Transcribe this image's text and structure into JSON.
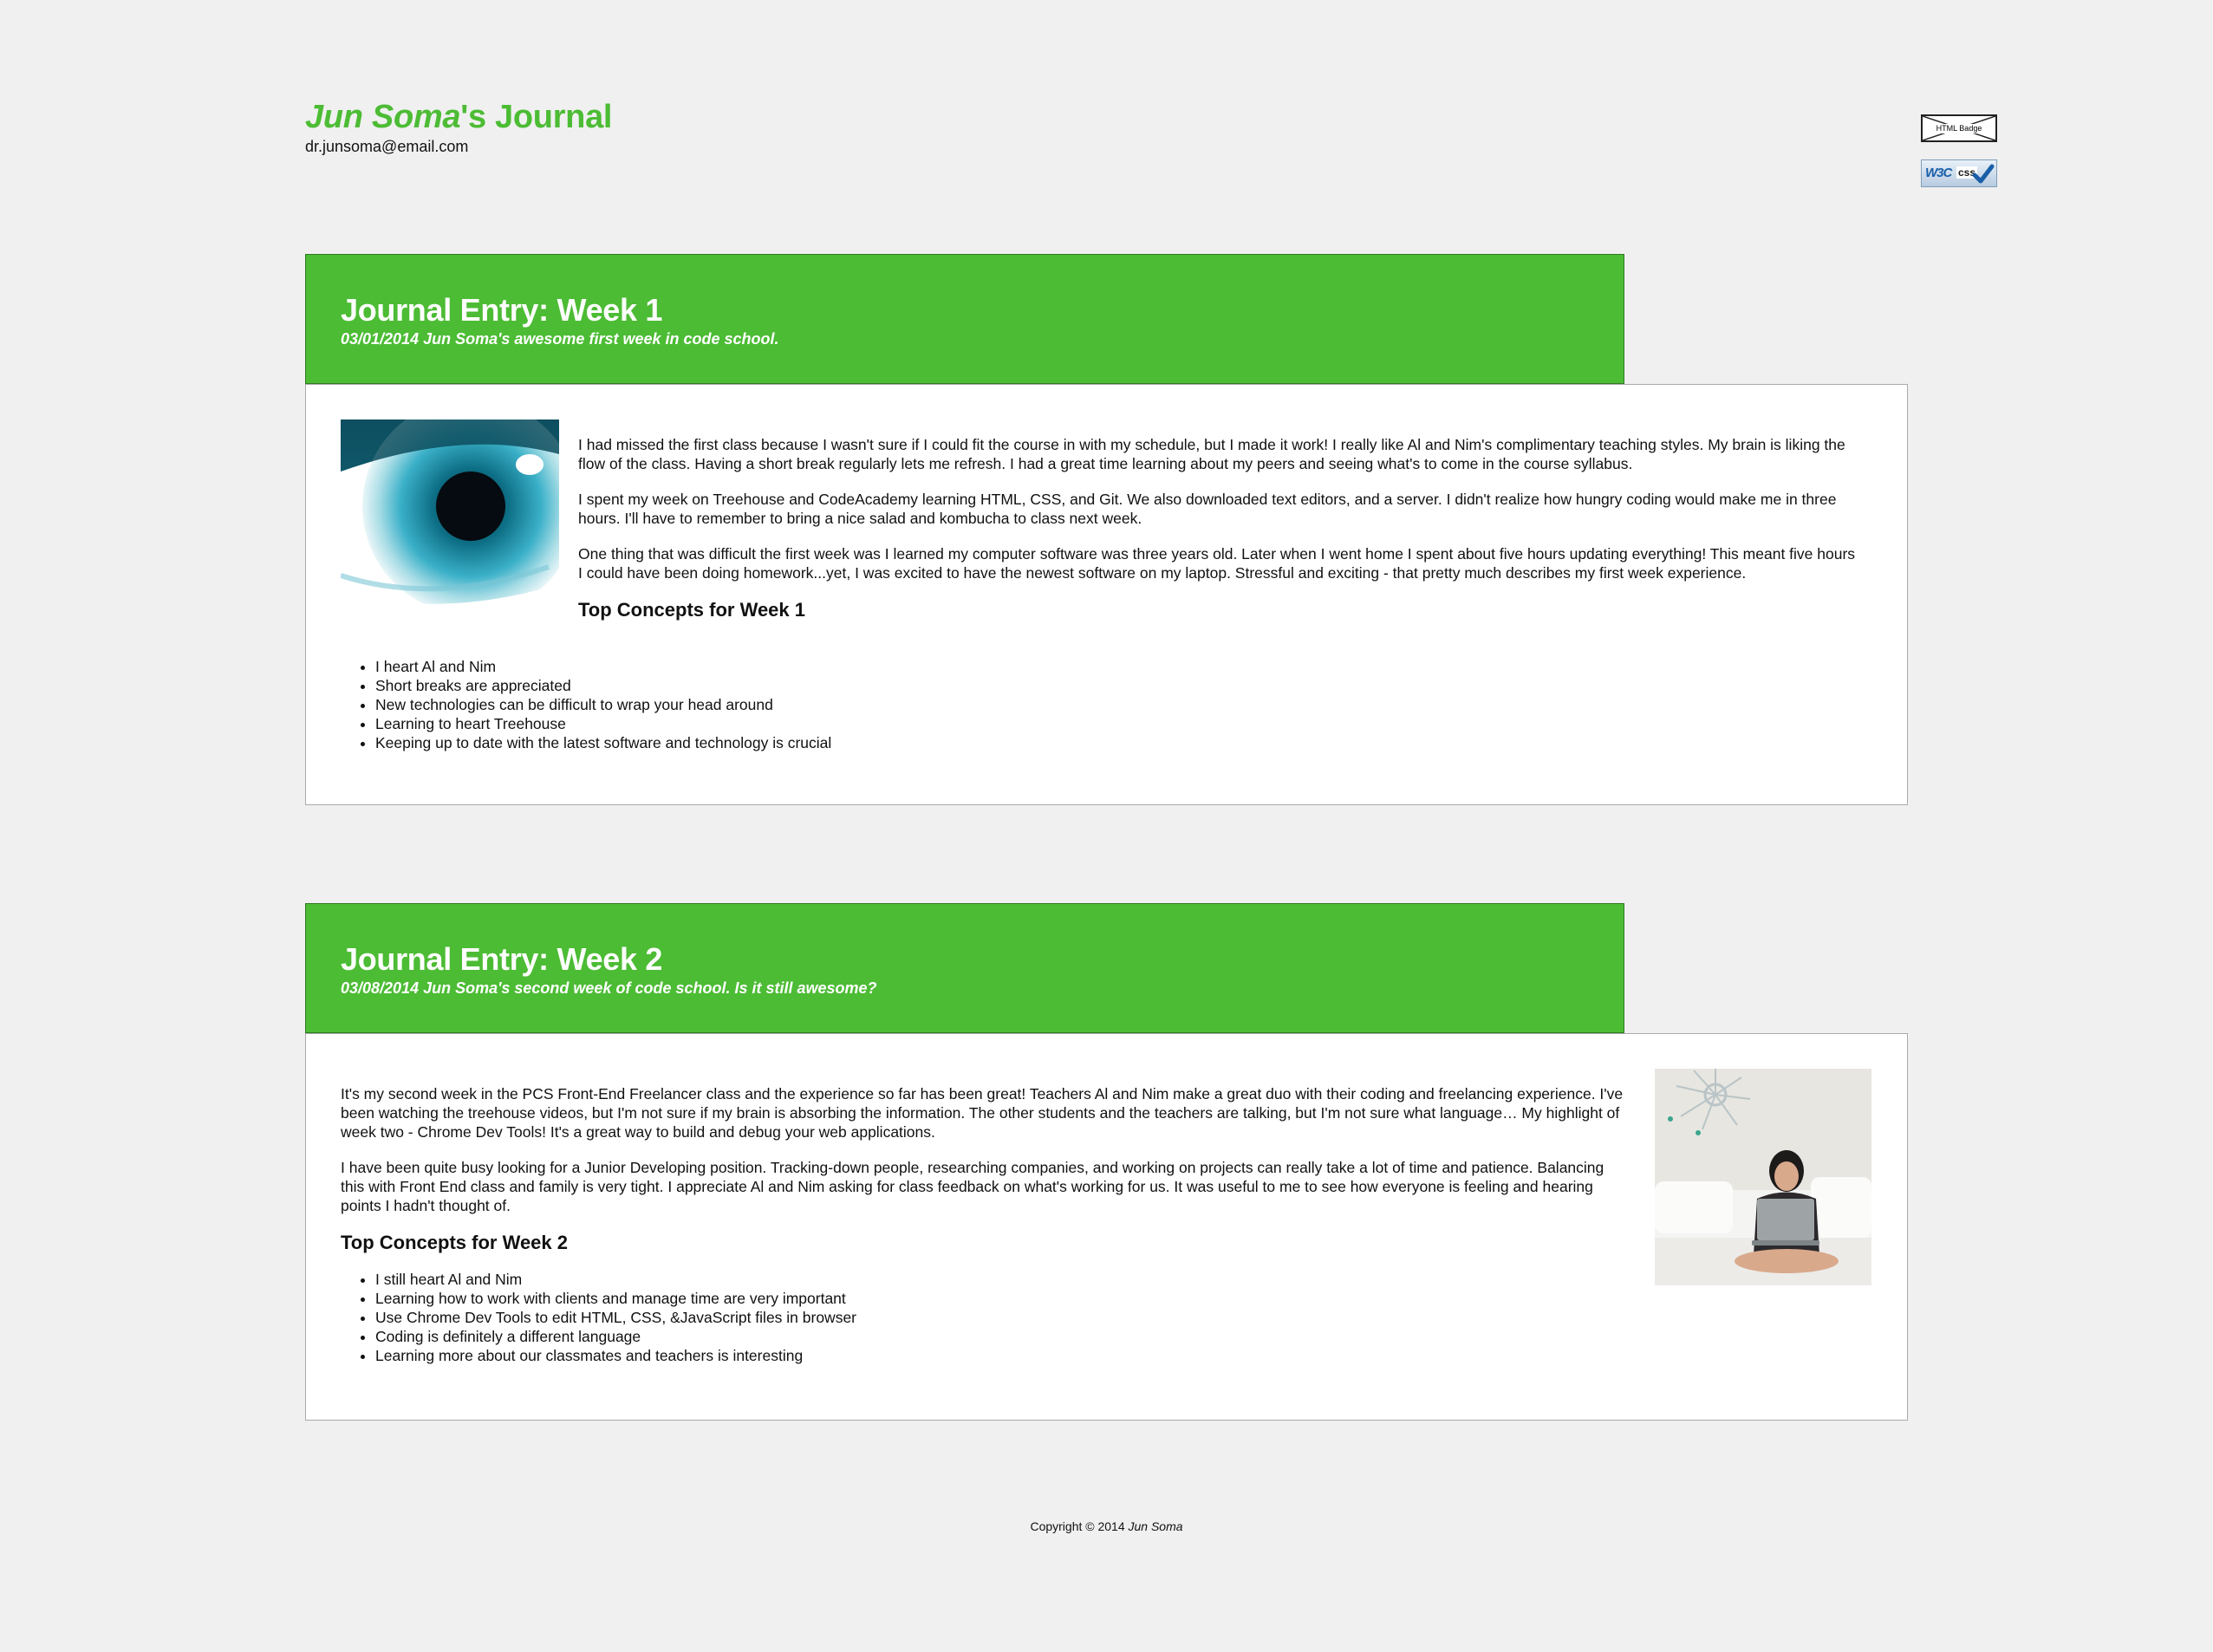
{
  "header": {
    "name": "Jun Soma",
    "title_suffix_possessive": "'s",
    "title_suffix_word": " Journal",
    "email": "dr.junsoma@email.com"
  },
  "badges": {
    "html_label": "HTML Badge",
    "css_w3c": "W3C",
    "css_label": "css"
  },
  "entries": [
    {
      "title": "Journal Entry: Week 1",
      "subtitle": "03/01/2014 Jun Soma's awesome first week in code school.",
      "paragraphs": [
        "I had missed the first class because I wasn't sure if I could fit the course in with my schedule, but I made it work! I really like Al and Nim's complimentary teaching styles. My brain is liking the flow of the class. Having a short break regularly lets me refresh. I had a great time learning about my peers and seeing what's to come in the course syllabus.",
        "I spent my week on Treehouse and CodeAcademy learning HTML, CSS, and Git. We also downloaded text editors, and a server. I didn't realize how hungry coding would make me in three hours. I'll have to remember to bring a nice salad and kombucha to class next week.",
        "One thing that was difficult the first week was I learned my computer software was three years old. Later when I went home I spent about five hours updating everything! This meant five hours I could have been doing homework...yet, I was excited to have the newest software on my laptop. Stressful and exciting - that pretty much describes my first week experience."
      ],
      "concepts_heading": "Top Concepts for Week 1",
      "concepts": [
        "I heart Al and Nim",
        "Short breaks are appreciated",
        "New technologies can be difficult to wrap your head around",
        "Learning to heart Treehouse",
        "Keeping up to date with the latest software and technology is crucial"
      ]
    },
    {
      "title": "Journal Entry: Week 2",
      "subtitle": "03/08/2014 Jun Soma's second week of code school. Is it still awesome?",
      "paragraphs": [
        "It's my second week in the PCS Front-End Freelancer class and the experience so far has been great! Teachers Al and Nim make a great duo with their coding and freelancing experience. I've been watching the treehouse videos, but I'm not sure if my brain is absorbing the information. The other students and the teachers are talking, but I'm not sure what language… My highlight of week two - Chrome Dev Tools! It's a great way to build and debug your web applications.",
        "I have been quite busy looking for a Junior Developing position. Tracking-down people, researching companies, and working on projects can really take a lot of time and patience. Balancing this with Front End class and family is very tight. I appreciate Al and Nim asking for class feedback on what's working for us. It was useful to me to see how everyone is feeling and hearing points I hadn't thought of."
      ],
      "concepts_heading": "Top Concepts for Week 2",
      "concepts": [
        "I still heart Al and Nim",
        "Learning how to work with clients and manage time are very important",
        "Use Chrome Dev Tools to edit HTML, CSS, &JavaScript files in browser",
        "Coding is definitely a different language",
        "Learning more about our classmates and teachers is interesting"
      ]
    }
  ],
  "footer": {
    "copyright": "Copyright © 2014 ",
    "name": "Jun Soma"
  },
  "colors": {
    "accent_green": "#4cbc34",
    "page_background": "#f0f0f0"
  }
}
